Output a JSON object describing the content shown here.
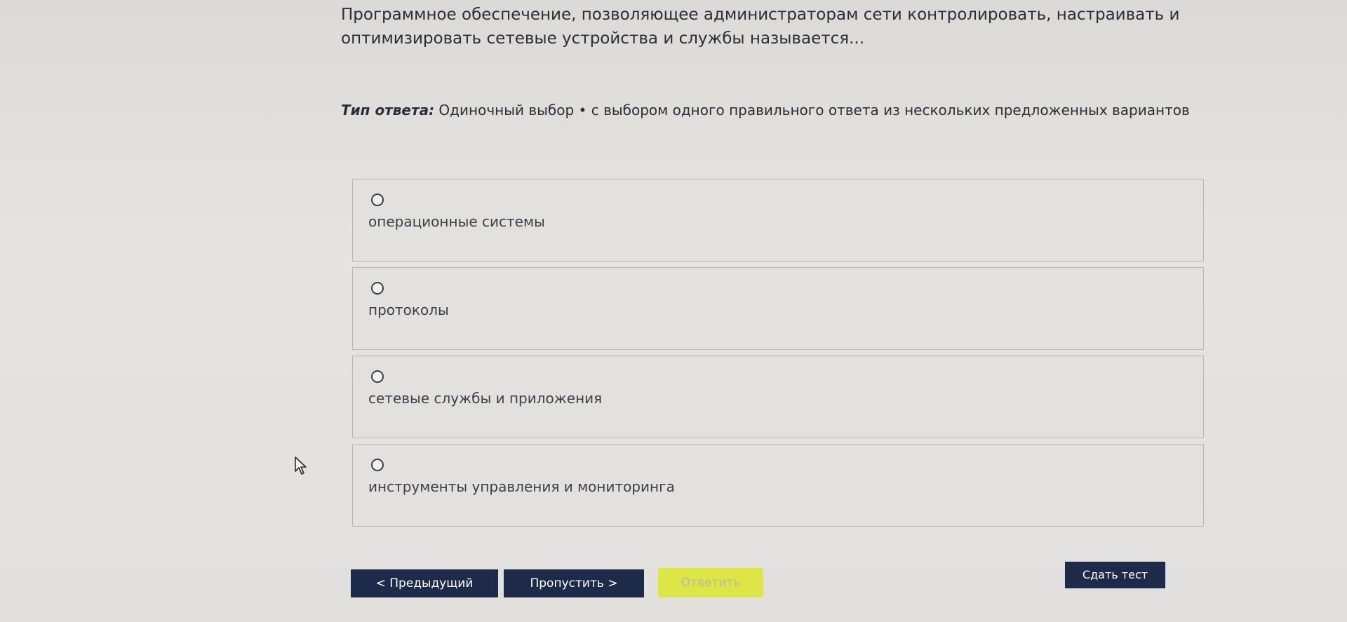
{
  "question": {
    "text": "Программное обеспечение, позволяющее администраторам сети контролировать, настраивать и оптимизировать сетевые устройства и службы называется..."
  },
  "answer_type": {
    "label": "Тип ответа:",
    "value": " Одиночный выбор • с выбором одного правильного ответа из нескольких предложенных вариантов"
  },
  "options": [
    {
      "label": "операционные системы",
      "selected": false
    },
    {
      "label": "протоколы",
      "selected": false
    },
    {
      "label": "сетевые службы и приложения",
      "selected": false
    },
    {
      "label": "инструменты управления и мониторинга",
      "selected": false
    }
  ],
  "buttons": {
    "prev": "< Предыдущий",
    "skip": "Пропустить >",
    "answer": "Ответить",
    "finish": "Сдать тест"
  },
  "colors": {
    "button_dark": "#1d2a4a",
    "answer_button": "#dde547"
  },
  "icons": {
    "cursor": "mouse-pointer-icon",
    "radio": "radio-button-icon"
  }
}
